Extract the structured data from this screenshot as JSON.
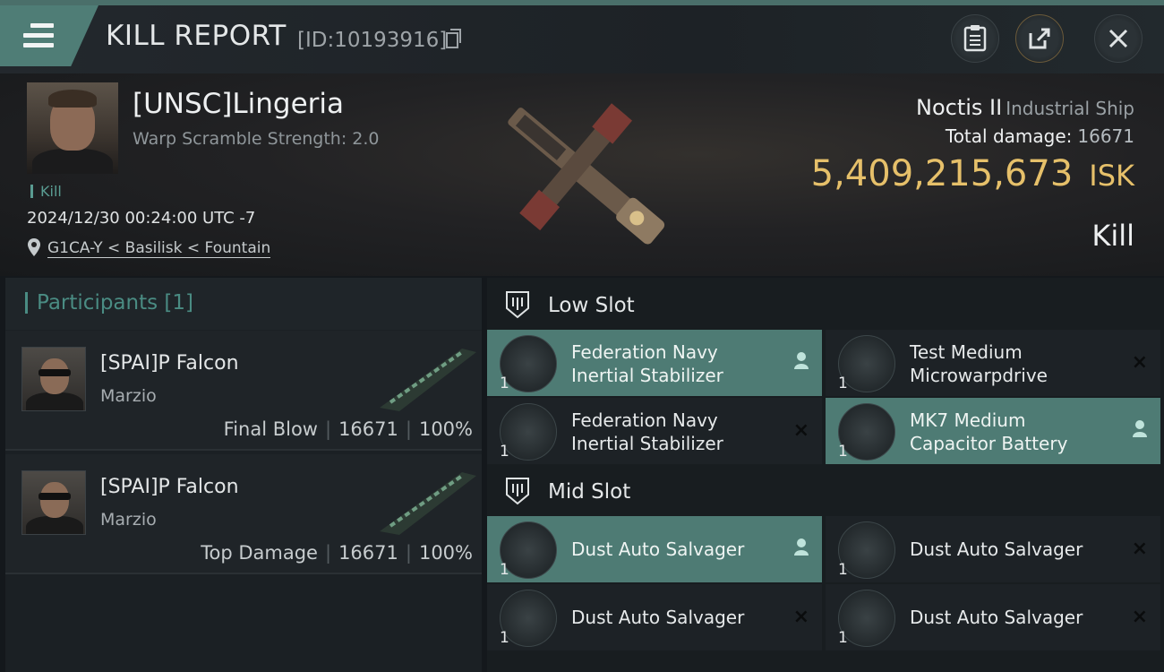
{
  "header": {
    "title": "KILL REPORT",
    "report_id": "[ID:10193916]",
    "buttons": [
      "clipboard-icon",
      "share-icon",
      "close-icon"
    ]
  },
  "victim": {
    "name": "[UNSC]Lingeria",
    "warp_scramble": "Warp Scramble Strength: 2.0",
    "kill_tag": "Kill",
    "datetime": "2024/12/30 00:24:00 UTC -7",
    "location": "G1CA-Y < Basilisk < Fountain"
  },
  "ship": {
    "name": "Noctis II",
    "class": "Industrial Ship",
    "total_damage_label": "Total damage:",
    "total_damage": "16671",
    "isk_value": "5,409,215,673",
    "isk_unit": "ISK",
    "result": "Kill"
  },
  "participants": {
    "title": "Participants [1]",
    "items": [
      {
        "name": "[SPAI]P Falcon",
        "corp": "Marzio",
        "role": "Final Blow",
        "damage": "16671",
        "percent": "100%"
      },
      {
        "name": "[SPAI]P Falcon",
        "corp": "Marzio",
        "role": "Top Damage",
        "damage": "16671",
        "percent": "100%"
      }
    ]
  },
  "slots": {
    "low": {
      "title": "Low Slot",
      "items": [
        {
          "name_line1": "Federation Navy",
          "name_line2": "Inertial Stabilizer",
          "qty": "1",
          "status": "dropped"
        },
        {
          "name_line1": "Test Medium",
          "name_line2": "Microwarpdrive",
          "qty": "1",
          "status": "destroyed"
        },
        {
          "name_line1": "Federation Navy",
          "name_line2": "Inertial Stabilizer",
          "qty": "1",
          "status": "destroyed"
        },
        {
          "name_line1": "MK7 Medium",
          "name_line2": "Capacitor Battery",
          "qty": "1",
          "status": "dropped"
        }
      ]
    },
    "mid": {
      "title": "Mid Slot",
      "items": [
        {
          "name": "Dust Auto Salvager",
          "qty": "1",
          "status": "dropped"
        },
        {
          "name": "Dust Auto Salvager",
          "qty": "1",
          "status": "destroyed"
        },
        {
          "name": "Dust Auto Salvager",
          "qty": "1",
          "status": "destroyed"
        },
        {
          "name": "Dust Auto Salvager",
          "qty": "1",
          "status": "destroyed"
        }
      ]
    }
  },
  "icons": {
    "destroyed": "×",
    "dropped": "person-icon"
  },
  "colors": {
    "accent": "#4e7b74",
    "isk": "#e6c06a"
  }
}
